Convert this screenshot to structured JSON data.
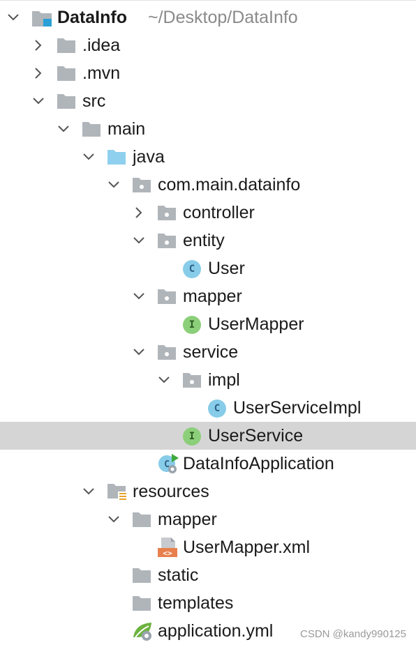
{
  "project": {
    "name": "DataInfo",
    "path": "~/Desktop/DataInfo"
  },
  "tree": [
    {
      "label": "DataInfo",
      "arrow": "down",
      "icon": "module-folder-icon"
    },
    {
      "label": ".idea",
      "arrow": "right",
      "icon": "folder-icon"
    },
    {
      "label": ".mvn",
      "arrow": "right",
      "icon": "folder-icon"
    },
    {
      "label": "src",
      "arrow": "down",
      "icon": "folder-icon"
    },
    {
      "label": "main",
      "arrow": "down",
      "icon": "folder-icon"
    },
    {
      "label": "java",
      "arrow": "down",
      "icon": "source-root-folder-icon"
    },
    {
      "label": "com.main.datainfo",
      "arrow": "down",
      "icon": "package-icon"
    },
    {
      "label": "controller",
      "arrow": "right",
      "icon": "package-icon"
    },
    {
      "label": "entity",
      "arrow": "down",
      "icon": "package-icon"
    },
    {
      "label": "User",
      "arrow": "",
      "icon": "class-icon"
    },
    {
      "label": "mapper",
      "arrow": "down",
      "icon": "package-icon"
    },
    {
      "label": "UserMapper",
      "arrow": "",
      "icon": "interface-icon"
    },
    {
      "label": "service",
      "arrow": "down",
      "icon": "package-icon"
    },
    {
      "label": "impl",
      "arrow": "down",
      "icon": "package-icon"
    },
    {
      "label": "UserServiceImpl",
      "arrow": "",
      "icon": "class-icon"
    },
    {
      "label": "UserService",
      "arrow": "",
      "icon": "interface-icon",
      "selected": true
    },
    {
      "label": "DataInfoApplication",
      "arrow": "",
      "icon": "spring-boot-class-icon"
    },
    {
      "label": "resources",
      "arrow": "down",
      "icon": "resources-folder-icon"
    },
    {
      "label": "mapper",
      "arrow": "down",
      "icon": "folder-icon"
    },
    {
      "label": "UserMapper.xml",
      "arrow": "",
      "icon": "xml-file-icon"
    },
    {
      "label": "static",
      "arrow": "",
      "icon": "folder-icon"
    },
    {
      "label": "templates",
      "arrow": "",
      "icon": "folder-icon"
    },
    {
      "label": "application.yml",
      "arrow": "",
      "icon": "spring-config-icon"
    }
  ],
  "badges": {
    "class": "C",
    "interface": "I"
  },
  "colors": {
    "folder": "#b0b5ba",
    "source_root": "#8fd0ee",
    "class_badge": "#87cce8",
    "class_letter": "#2e5f86",
    "interface_badge": "#8ccf7a",
    "interface_letter": "#2c5a21",
    "selection": "#d5d5d5",
    "xml": "#e8804d",
    "spring": "#6db33f"
  },
  "watermark": "CSDN @kandy990125"
}
